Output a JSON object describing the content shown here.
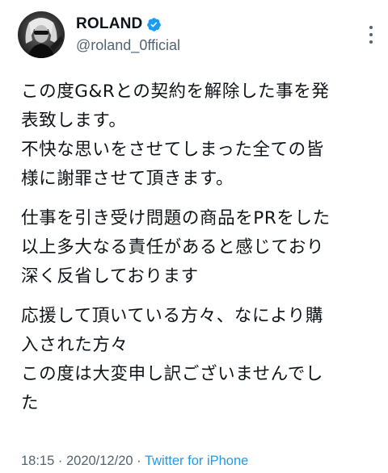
{
  "tweet": {
    "author": {
      "display_name": "ROLAND",
      "handle": "@roland_0fficial",
      "verified": true
    },
    "paragraphs": [
      {
        "lines": [
          "この度G&Rとの契約を解除した事を発",
          "表致します。",
          "不快な思いをさせてしまった全ての皆",
          "様に謝罪させて頂きます。"
        ]
      },
      {
        "lines": [
          "仕事を引き受け問題の商品をPRをした",
          "以上多大なる責任があると感じており",
          "深く反省しております"
        ]
      },
      {
        "lines": [
          "応援して頂いている方々、なにより購",
          "入された方々",
          "この度は大変申し訳ございませんでし",
          "た"
        ]
      }
    ],
    "meta": {
      "time": "18:15",
      "separator": " · ",
      "date": "2020/12/20",
      "separator2": " · ",
      "source": "Twitter for iPhone"
    }
  },
  "colors": {
    "text": "#0f1419",
    "secondary": "#536471",
    "accent": "#1d9bf0"
  },
  "icons": {
    "verified": "verified-badge-icon",
    "more": "more-options-icon"
  }
}
